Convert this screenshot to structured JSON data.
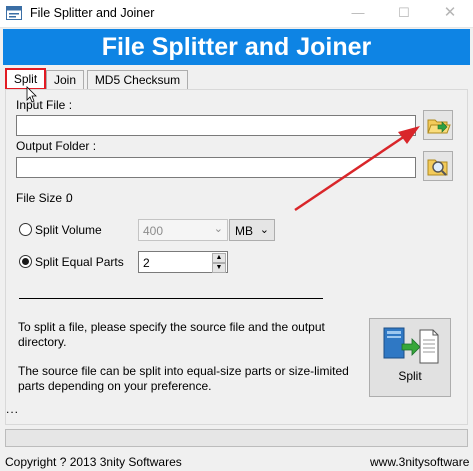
{
  "window": {
    "title": "File Splitter and Joiner",
    "minimize_glyph": "—",
    "maximize_glyph": "☐",
    "close_glyph": "✕"
  },
  "banner": {
    "text": "File Splitter and Joiner"
  },
  "tabs": [
    {
      "label": "Split",
      "selected": true
    },
    {
      "label": "Join",
      "selected": false
    },
    {
      "label": "MD5 Checksum",
      "selected": false
    }
  ],
  "split": {
    "input_file": {
      "label": "Input File :",
      "value": ""
    },
    "output_folder": {
      "label": "Output Folder :",
      "value": ""
    },
    "file_size": {
      "label": "File Size :",
      "value": "0"
    },
    "split_volume": {
      "label": "Split Volume",
      "selected": false,
      "value": "400",
      "unit": "MB"
    },
    "split_equal_parts": {
      "label": "Split Equal Parts",
      "selected": true,
      "value": "2"
    },
    "info_line1": "To split a file, please specify the source file and the output directory.",
    "info_line2": "The source file can be split into equal-size parts or size-limited parts depending on your preference.",
    "split_button_label": "Split",
    "status_text": "...",
    "progress": 0.0
  },
  "footer": {
    "copyright": "Copyright ? 2013 3nity Softwares",
    "website": "www.3nitysoftware"
  },
  "colors": {
    "banner_blue": "#0e84e4",
    "highlight_red": "#e21b23",
    "arrow_red": "#d9262a",
    "progress_green": "#06b025"
  },
  "icons": [
    "app-icon",
    "folder-open-icon",
    "folder-search-icon",
    "split-document-icon"
  ]
}
